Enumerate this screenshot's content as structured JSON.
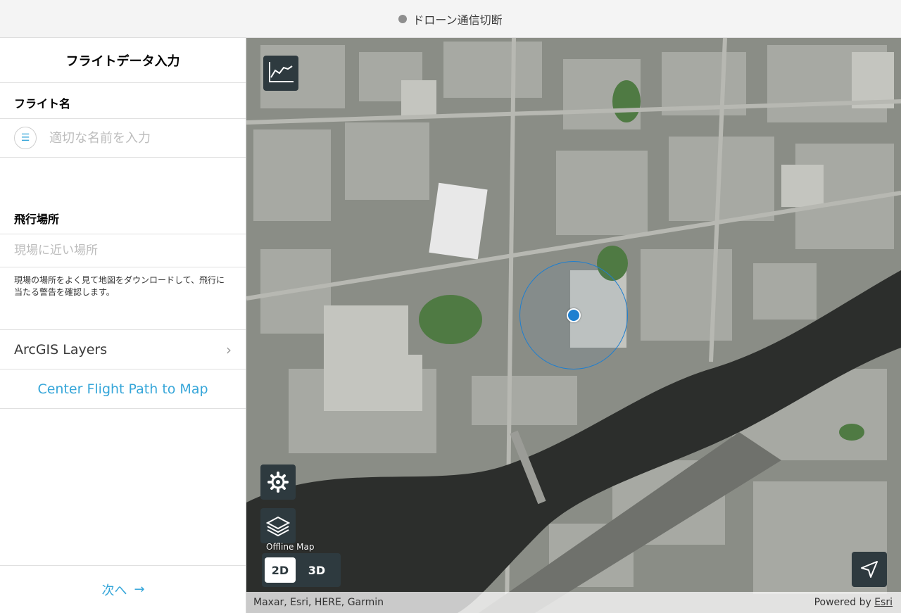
{
  "status": {
    "text": "ドローン通信切断",
    "dot_color": "#8e8e8e"
  },
  "panel": {
    "title": "フライトデータ入力",
    "flight_name_label": "フライト名",
    "flight_name_placeholder": "適切な名前を入力",
    "flight_name_value": "",
    "location_label": "飛行場所",
    "location_placeholder": "現場に近い場所",
    "location_value": "",
    "hint": "現場の場所をよく見て地図をダウンロードして、飛行に当たる警告を確認します。",
    "layers_label": "ArcGIS Layers",
    "center_button": "Center Flight Path to Map",
    "next_label": "次へ",
    "accent_color": "#36a6d9"
  },
  "map": {
    "offline_label": "Offline Map",
    "view_modes": [
      "2D",
      "3D"
    ],
    "selected_view_mode": "2D",
    "attribution": "Maxar, Esri, HERE, Garmin",
    "powered_by_prefix": "Powered by",
    "powered_by_link": "Esri",
    "icons": {
      "chart": "line-chart-icon",
      "settings": "gear-icon",
      "layers": "layers-icon",
      "locate": "navigation-arrow-icon"
    }
  }
}
